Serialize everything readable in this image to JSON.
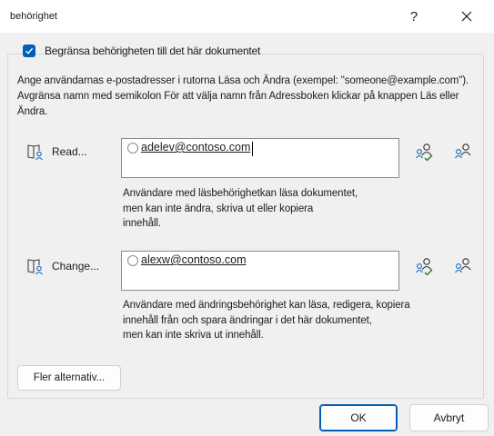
{
  "window": {
    "title": "behörighet",
    "help_glyph": "?",
    "close_icon": "close-icon"
  },
  "restrict": {
    "checked": true,
    "label": "Begränsa behörigheten till det här dokumentet"
  },
  "instructions": "Ange användarnas e-postadresser i rutorna Läsa och Ändra (exempel: \"someone@example.com\"). Avgränsa namn med semikolon För att välja namn från Adressboken klickar på knappen Läs eller Ändra.",
  "read": {
    "button_label": "Read...",
    "address": "adelev@contoso.com",
    "description": [
      "Användare med läsbehörighetkan läsa dokumentet,",
      "men kan inte ändra, skriva ut eller kopiera",
      "innehåll."
    ]
  },
  "change": {
    "button_label": "Change...",
    "address": "alexw@contoso.com",
    "description": [
      "Användare med ändringsbehörighet kan läsa, redigera, kopiera",
      "innehåll från och spara ändringar i det här dokumentet,",
      "men kan inte skriva ut innehåll."
    ]
  },
  "buttons": {
    "more_options": "Fler alternativ...",
    "ok": "OK",
    "cancel": "Avbryt"
  },
  "colors": {
    "accent": "#005fb8",
    "check_green": "#107c10",
    "people_blue": "#0f6cbd"
  }
}
